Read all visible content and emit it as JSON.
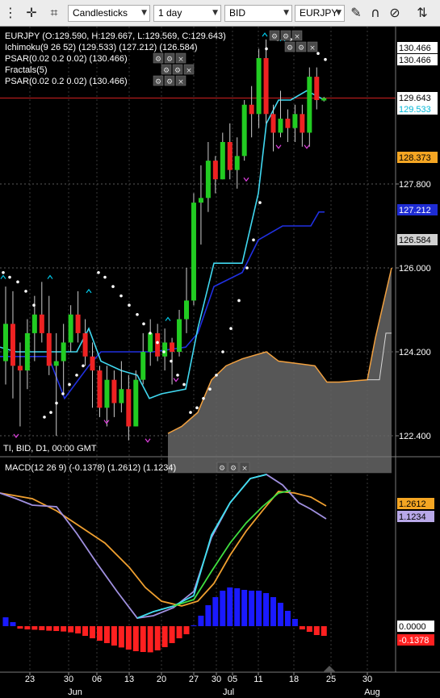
{
  "toolbar": {
    "chart_type": "Candlesticks",
    "timeframe": "1 day",
    "price_type": "BID",
    "symbol": "EURJPY",
    "icons": [
      "crosshair-icon",
      "crop-icon",
      "pencil-icon",
      "magnet-icon",
      "eye-slash-icon",
      "sort-icon"
    ]
  },
  "main_pane": {
    "header_lines": [
      "EURJPY (O:129.590, H:129.667, L:129.569, C:129.643)",
      "Ichimoku(9 26 52) (129.533) (127.212) (126.584)",
      "PSAR(0.02 0.2 0.02) (130.466)",
      "Fractals(5)",
      "PSAR(0.02 0.2 0.02) (130.466)"
    ],
    "footer": "TI, BID, D1, 00:00 GMT",
    "price_ticks": [
      "127.800",
      "126.000",
      "124.200",
      "122.400"
    ],
    "tags": [
      {
        "text": "130.466",
        "price": 130.62,
        "bg": "#ffffff",
        "fg": "#000000"
      },
      {
        "text": "130.466",
        "price": 130.466,
        "bg": "#ffffff",
        "fg": "#000000"
      },
      {
        "text": "129.643",
        "price": 129.643,
        "bg": "#ffffff",
        "fg": "#000000"
      },
      {
        "text": "129.533",
        "price": 129.533,
        "bg": "#ffffff",
        "fg": "#00b8d8"
      },
      {
        "text": "128.373",
        "price": 128.373,
        "bg": "#f5a623",
        "fg": "#000000"
      },
      {
        "text": "127.212",
        "price": 127.212,
        "bg": "#1e2cd4",
        "fg": "#ffffff"
      },
      {
        "text": "126.584",
        "price": 126.584,
        "bg": "#d0d0d0",
        "fg": "#000000"
      }
    ]
  },
  "macd_pane": {
    "header": "MACD(12 26 9) (-0.1378) (1.2612) (1.1234)",
    "tags": [
      {
        "text": "1.2612",
        "value": 1.2612,
        "bg": "#f5a623",
        "fg": "#000000"
      },
      {
        "text": "1.1234",
        "value": 1.1234,
        "bg": "#b8a8e8",
        "fg": "#000000"
      },
      {
        "text": "0.0000",
        "value": 0.0,
        "bg": "#ffffff",
        "fg": "#000000"
      },
      {
        "text": "-0.1378",
        "value": -0.1378,
        "bg": "#ff2020",
        "fg": "#ffffff"
      }
    ]
  },
  "x_axis": {
    "day_labels": [
      "23",
      "30",
      "06",
      "13",
      "20",
      "27",
      "30",
      "05",
      "11",
      "18",
      "25",
      "30"
    ],
    "month_labels": [
      "Jun",
      "Jul",
      "Aug"
    ]
  },
  "chart_data": {
    "type": "candlestick",
    "symbol": "EURJPY",
    "timeframe": "D1",
    "y_range": [
      121.8,
      131.0
    ],
    "candles": [
      {
        "o": 124.0,
        "h": 125.6,
        "l": 123.5,
        "c": 124.8
      },
      {
        "o": 124.8,
        "h": 125.5,
        "l": 123.2,
        "c": 123.9
      },
      {
        "o": 123.9,
        "h": 124.4,
        "l": 122.6,
        "c": 123.8
      },
      {
        "o": 123.8,
        "h": 124.9,
        "l": 123.4,
        "c": 124.6
      },
      {
        "o": 124.6,
        "h": 125.4,
        "l": 124.0,
        "c": 125.0
      },
      {
        "o": 125.0,
        "h": 125.7,
        "l": 124.4,
        "c": 124.6
      },
      {
        "o": 124.6,
        "h": 125.4,
        "l": 123.7,
        "c": 123.9
      },
      {
        "o": 123.9,
        "h": 124.6,
        "l": 122.4,
        "c": 124.0
      },
      {
        "o": 124.0,
        "h": 124.8,
        "l": 123.3,
        "c": 124.4
      },
      {
        "o": 124.4,
        "h": 125.2,
        "l": 124.2,
        "c": 125.0
      },
      {
        "o": 125.0,
        "h": 125.5,
        "l": 124.4,
        "c": 124.6
      },
      {
        "o": 124.6,
        "h": 124.9,
        "l": 123.9,
        "c": 124.1
      },
      {
        "o": 124.1,
        "h": 124.4,
        "l": 123.0,
        "c": 123.8
      },
      {
        "o": 123.8,
        "h": 123.9,
        "l": 122.8,
        "c": 123.0
      },
      {
        "o": 123.0,
        "h": 123.9,
        "l": 122.6,
        "c": 123.6
      },
      {
        "o": 123.6,
        "h": 123.8,
        "l": 122.8,
        "c": 123.1
      },
      {
        "o": 123.1,
        "h": 124.0,
        "l": 122.9,
        "c": 123.4
      },
      {
        "o": 123.4,
        "h": 123.7,
        "l": 122.3,
        "c": 122.6
      },
      {
        "o": 122.6,
        "h": 123.8,
        "l": 122.6,
        "c": 123.6
      },
      {
        "o": 123.6,
        "h": 124.6,
        "l": 123.5,
        "c": 124.2
      },
      {
        "o": 124.2,
        "h": 124.9,
        "l": 123.9,
        "c": 124.6
      },
      {
        "o": 124.6,
        "h": 124.8,
        "l": 124.0,
        "c": 124.1
      },
      {
        "o": 124.1,
        "h": 124.7,
        "l": 123.8,
        "c": 124.4
      },
      {
        "o": 124.4,
        "h": 124.5,
        "l": 123.5,
        "c": 124.2
      },
      {
        "o": 124.2,
        "h": 125.1,
        "l": 124.1,
        "c": 124.9
      },
      {
        "o": 124.9,
        "h": 126.0,
        "l": 124.6,
        "c": 125.3
      },
      {
        "o": 125.3,
        "h": 127.6,
        "l": 125.2,
        "c": 127.4
      },
      {
        "o": 127.4,
        "h": 128.2,
        "l": 126.5,
        "c": 127.5
      },
      {
        "o": 127.5,
        "h": 128.7,
        "l": 127.2,
        "c": 128.3
      },
      {
        "o": 128.3,
        "h": 128.4,
        "l": 127.6,
        "c": 127.9
      },
      {
        "o": 127.9,
        "h": 128.9,
        "l": 127.9,
        "c": 128.7
      },
      {
        "o": 128.7,
        "h": 129.1,
        "l": 127.9,
        "c": 128.1
      },
      {
        "o": 128.1,
        "h": 128.8,
        "l": 127.7,
        "c": 128.4
      },
      {
        "o": 128.4,
        "h": 129.6,
        "l": 128.3,
        "c": 129.5
      },
      {
        "o": 129.5,
        "h": 129.9,
        "l": 128.8,
        "c": 129.3
      },
      {
        "o": 129.3,
        "h": 130.7,
        "l": 129.0,
        "c": 130.5
      },
      {
        "o": 130.5,
        "h": 130.9,
        "l": 129.1,
        "c": 129.3
      },
      {
        "o": 129.3,
        "h": 129.5,
        "l": 128.5,
        "c": 128.9
      },
      {
        "o": 128.9,
        "h": 129.8,
        "l": 128.8,
        "c": 129.2
      },
      {
        "o": 129.2,
        "h": 129.4,
        "l": 128.7,
        "c": 129.0
      },
      {
        "o": 129.0,
        "h": 129.5,
        "l": 128.7,
        "c": 129.3
      },
      {
        "o": 129.3,
        "h": 129.5,
        "l": 128.6,
        "c": 128.9
      },
      {
        "o": 128.9,
        "h": 130.3,
        "l": 128.6,
        "c": 130.1
      },
      {
        "o": 130.1,
        "h": 130.3,
        "l": 129.4,
        "c": 129.6
      },
      {
        "o": 129.59,
        "h": 129.667,
        "l": 129.569,
        "c": 129.643
      }
    ],
    "ichimoku": {
      "tenkan": 129.533,
      "kijun": 127.212,
      "span_value": 126.584
    },
    "psar": 130.466,
    "macd": {
      "macd": -0.1378,
      "signal": 1.2612,
      "hist_label": 1.1234
    }
  }
}
